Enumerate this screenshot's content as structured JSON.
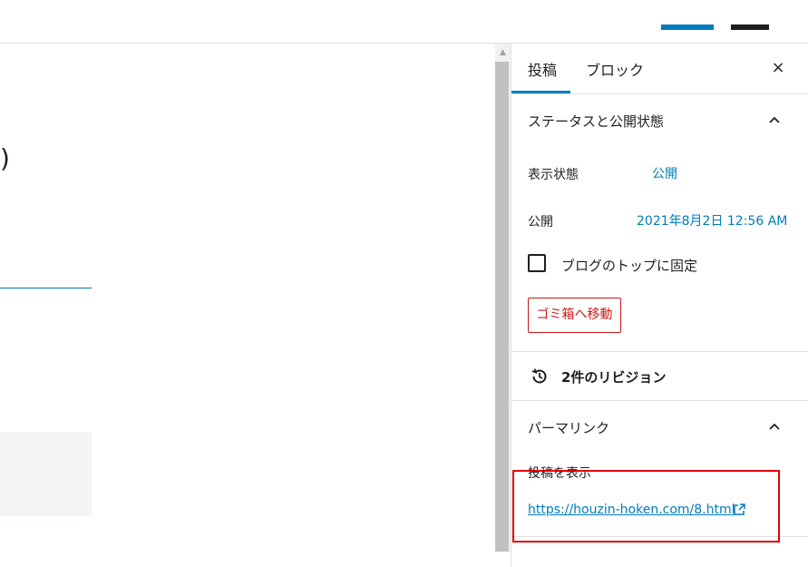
{
  "editor": {
    "title_fragment": ")"
  },
  "sidebar": {
    "tabs": [
      {
        "label": "投稿"
      },
      {
        "label": "ブロック"
      }
    ],
    "close_label": "×",
    "status_panel": {
      "title": "ステータスと公開状態",
      "visibility_label": "表示状態",
      "visibility_value": "公開",
      "publish_label": "公開",
      "publish_value": "2021年8月2日 12:56 AM",
      "sticky_label": "ブログのトップに固定",
      "sticky_checked": false,
      "trash_label": "ゴミ箱へ移動"
    },
    "revisions_label": "2件のリビジョン",
    "permalink_panel": {
      "title": "パーマリンク",
      "view_post_label": "投稿を表示",
      "url": "https://houzin-hoken.com/8.html"
    }
  },
  "colors": {
    "accent": "#007cba",
    "danger": "#cc1818",
    "highlight_box": "#e00000"
  }
}
